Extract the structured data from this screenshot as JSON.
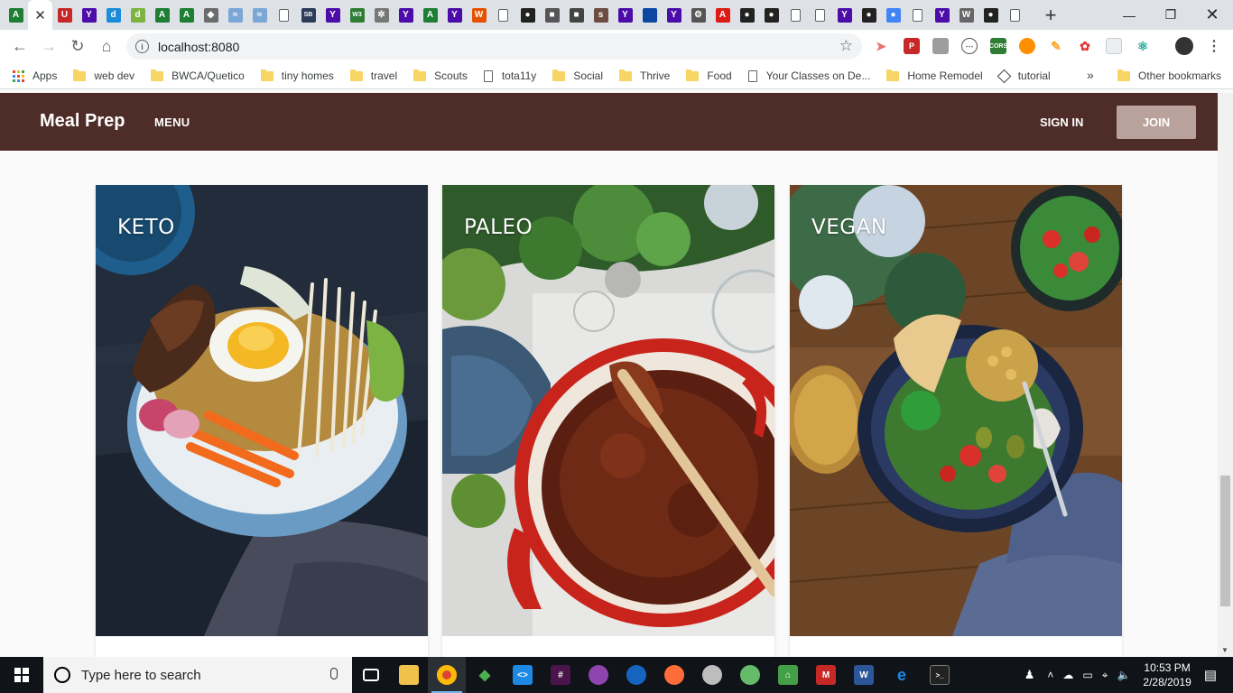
{
  "browser": {
    "tabs": [
      {
        "icon": "android-studio-icon",
        "glyph": "A",
        "color": "#1e7e34"
      },
      {
        "icon": "close-icon",
        "glyph": "✕",
        "color": "",
        "active": true
      },
      {
        "icon": "bookmark-red-icon",
        "glyph": "U",
        "color": "#c62828"
      },
      {
        "icon": "yahoo-icon",
        "glyph": "Y",
        "color": "#4b0ca8"
      },
      {
        "icon": "d-icon",
        "glyph": "d",
        "color": "#1a8cd8"
      },
      {
        "icon": "d-green-icon",
        "glyph": "d",
        "color": "#7cb342"
      },
      {
        "icon": "android-studio-icon",
        "glyph": "A",
        "color": "#1e7e34"
      },
      {
        "icon": "android-studio-icon",
        "glyph": "A",
        "color": "#1e7e34"
      },
      {
        "icon": "diamond-icon",
        "glyph": "◆",
        "color": "#6b6b6b"
      },
      {
        "icon": "wave-icon",
        "glyph": "≈",
        "color": "#7aa7d6"
      },
      {
        "icon": "wave-icon",
        "glyph": "≈",
        "color": "#7aa7d6"
      },
      {
        "icon": "page-icon",
        "glyph": "",
        "color": "#ffffff"
      },
      {
        "icon": "sb-icon",
        "glyph": "SB",
        "color": "#2e3a59"
      },
      {
        "icon": "yahoo-icon",
        "glyph": "Y",
        "color": "#4b0ca8"
      },
      {
        "icon": "w3-icon",
        "glyph": "W3",
        "color": "#2e7d32"
      },
      {
        "icon": "gear-icon",
        "glyph": "✲",
        "color": "#777777"
      },
      {
        "icon": "yahoo-icon",
        "glyph": "Y",
        "color": "#4b0ca8"
      },
      {
        "icon": "android-studio-icon",
        "glyph": "A",
        "color": "#1e7e34"
      },
      {
        "icon": "yahoo-icon",
        "glyph": "Y",
        "color": "#4b0ca8"
      },
      {
        "icon": "w-orange-icon",
        "glyph": "W",
        "color": "#e65100"
      },
      {
        "icon": "page-icon",
        "glyph": "",
        "color": "#ffffff"
      },
      {
        "icon": "github-icon",
        "glyph": "●",
        "color": "#222222"
      },
      {
        "icon": "cube-icon",
        "glyph": "■",
        "color": "#555555"
      },
      {
        "icon": "cube-icon",
        "glyph": "■",
        "color": "#444444"
      },
      {
        "icon": "story-icon",
        "glyph": "s",
        "color": "#6d4c41"
      },
      {
        "icon": "yahoo-icon",
        "glyph": "Y",
        "color": "#4b0ca8"
      },
      {
        "icon": "square-blue-icon",
        "glyph": "",
        "color": "#0d47a1"
      },
      {
        "icon": "yahoo-icon",
        "glyph": "Y",
        "color": "#4b0ca8"
      },
      {
        "icon": "gear-icon",
        "glyph": "⚙",
        "color": "#555555"
      },
      {
        "icon": "angular-icon",
        "glyph": "A",
        "color": "#dd1b16"
      },
      {
        "icon": "github-icon",
        "glyph": "●",
        "color": "#222222"
      },
      {
        "icon": "github-icon",
        "glyph": "●",
        "color": "#222222"
      },
      {
        "icon": "page-icon",
        "glyph": "",
        "color": "#ffffff"
      },
      {
        "icon": "page-icon",
        "glyph": "",
        "color": "#ffffff"
      },
      {
        "icon": "yahoo-icon",
        "glyph": "Y",
        "color": "#4b0ca8"
      },
      {
        "icon": "github-icon",
        "glyph": "●",
        "color": "#222222"
      },
      {
        "icon": "google-icon",
        "glyph": "●",
        "color": "#4285f4"
      },
      {
        "icon": "page-icon",
        "glyph": "",
        "color": "#ffffff"
      },
      {
        "icon": "yahoo-icon",
        "glyph": "Y",
        "color": "#4b0ca8"
      },
      {
        "icon": "wikipedia-icon",
        "glyph": "W",
        "color": "#666666"
      },
      {
        "icon": "github-icon",
        "glyph": "●",
        "color": "#222222"
      },
      {
        "icon": "page-icon",
        "glyph": "",
        "color": "#ffffff"
      }
    ],
    "new_tab": "+",
    "url": "localhost:8080",
    "info_glyph": "i",
    "bookmarks": [
      {
        "label": "Apps",
        "type": "apps"
      },
      {
        "label": "web dev",
        "type": "folder"
      },
      {
        "label": "BWCA/Quetico",
        "type": "folder"
      },
      {
        "label": "tiny homes",
        "type": "folder"
      },
      {
        "label": "travel",
        "type": "folder"
      },
      {
        "label": "Scouts",
        "type": "folder"
      },
      {
        "label": "tota11y",
        "type": "page"
      },
      {
        "label": "Social",
        "type": "folder"
      },
      {
        "label": "Thrive",
        "type": "folder"
      },
      {
        "label": "Food",
        "type": "folder"
      },
      {
        "label": "Your Classes on De...",
        "type": "page"
      },
      {
        "label": "Home Remodel",
        "type": "folder"
      },
      {
        "label": "tutorial",
        "type": "diamond"
      }
    ],
    "overflow": "»",
    "other_bookmarks": "Other bookmarks"
  },
  "site": {
    "brand": "Meal Prep",
    "menu": "MENU",
    "sign_in": "SIGN IN",
    "join": "JOIN",
    "header_color": "#4e2c27",
    "join_color": "#b9a29c",
    "cards": [
      {
        "label": "KETO",
        "image": "ramen-bowl-photo"
      },
      {
        "label": "PALEO",
        "image": "chili-pot-photo"
      },
      {
        "label": "VEGAN",
        "image": "salad-bowl-photo"
      }
    ]
  },
  "taskbar": {
    "search_placeholder": "Type here to search",
    "time": "10:53 PM",
    "date": "2/28/2019"
  }
}
